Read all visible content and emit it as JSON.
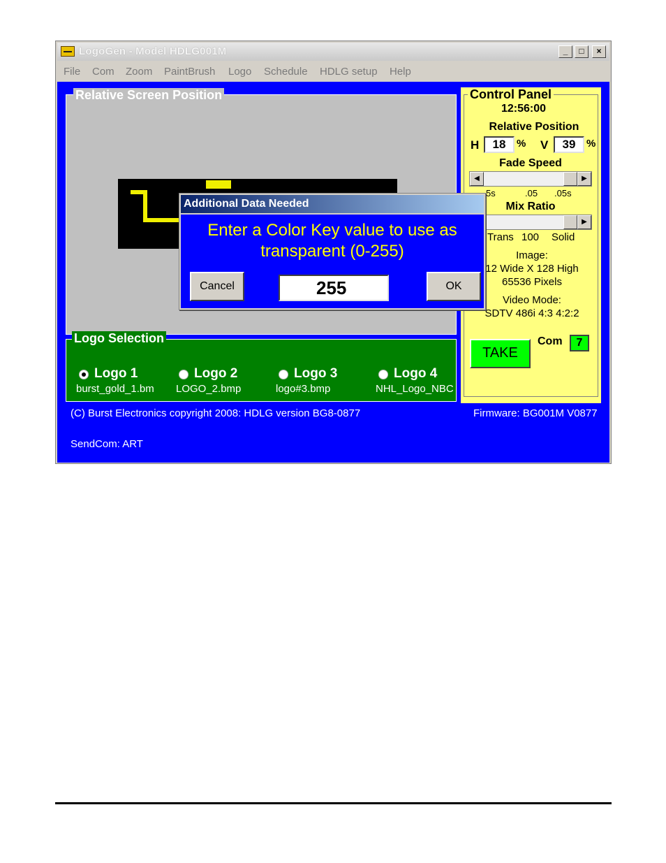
{
  "window": {
    "title": "LogoGen - Model HDLG001M",
    "min_glyph": "_",
    "max_glyph": "□",
    "close_glyph": "×"
  },
  "menu": [
    "File",
    "Com",
    "Zoom",
    "PaintBrush",
    "Logo",
    "Schedule",
    "HDLG setup",
    "Help"
  ],
  "screen_position": {
    "label": "Relative Screen Position"
  },
  "logo_selection": {
    "label": "Logo Selection",
    "logos": [
      {
        "label": "Logo 1",
        "file": "burst_gold_1.bm",
        "selected": true
      },
      {
        "label": "Logo 2",
        "file": "LOGO_2.bmp",
        "selected": false
      },
      {
        "label": "Logo 3",
        "file": "logo#3.bmp",
        "selected": false
      },
      {
        "label": "Logo 4",
        "file": "NHL_Logo_NBC",
        "selected": false
      }
    ]
  },
  "status": {
    "copyright": "(C) Burst Electronics copyright 2008: HDLG version BG8-0877",
    "firmware": "Firmware: BG001M V0877",
    "sendcom": "SendCom: ART"
  },
  "control_panel": {
    "title": "Control Panel",
    "time": "12:56:00",
    "relative_position_label": "Relative Position",
    "h_label": "H",
    "h_value": "18",
    "v_label": "V",
    "v_value": "39",
    "pct": "%",
    "fade_speed_label": "Fade Speed",
    "fade_ticks": [
      "5s",
      ".05",
      ".05s"
    ],
    "mix_ratio_label": "Mix Ratio",
    "mix_ticks": [
      "Trans",
      "100",
      "Solid"
    ],
    "image_label": "Image:",
    "image_size": "12 Wide X 128 High",
    "image_pixels": "65536 Pixels",
    "video_mode_label": "Video Mode:",
    "video_mode": "SDTV 486i 4:3 4:2:2",
    "take_label": "TAKE",
    "com_label": "Com",
    "com_value": "7"
  },
  "dialog": {
    "title": "Additional Data Needed",
    "message_line1": "Enter a Color Key value to use as",
    "message_line2": "transparent  (0-255)",
    "cancel_label": "Cancel",
    "ok_label": "OK",
    "input_value": "255"
  }
}
